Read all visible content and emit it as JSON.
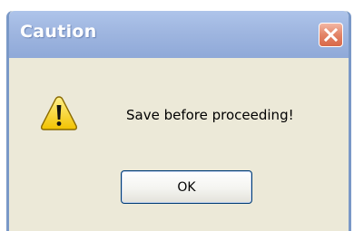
{
  "window": {
    "title": "Caution",
    "close_icon": "close-icon"
  },
  "message": {
    "icon": "warning-icon",
    "text": "Save before proceeding!"
  },
  "buttons": {
    "ok_label": "OK"
  },
  "colors": {
    "titlebar": "#9fb6e0",
    "dialog_background": "#ece9d8",
    "close_button": "#e38467",
    "warning_yellow": "#f6d31c"
  }
}
